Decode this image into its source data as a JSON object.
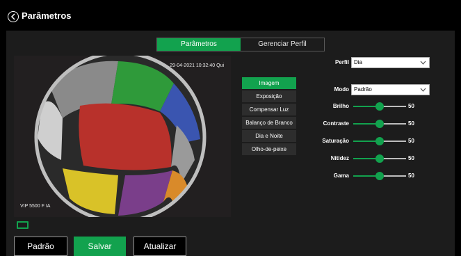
{
  "header": {
    "title": "Parâmetros",
    "back_icon": "chevron-left-circle-icon"
  },
  "tabs": [
    {
      "label": "Parâmetros",
      "active": true
    },
    {
      "label": "Gerenciar Perfil",
      "active": false
    }
  ],
  "preview": {
    "timestamp": "29-04-2021 10:32:40 Qui",
    "model": "VIP 5500 F IA"
  },
  "side_menu": [
    {
      "label": "Imagem",
      "active": true
    },
    {
      "label": "Exposição",
      "active": false
    },
    {
      "label": "Compensar Luz",
      "active": false
    },
    {
      "label": "Balanço de Branco",
      "active": false
    },
    {
      "label": "Dia e Noite",
      "active": false
    },
    {
      "label": "Olho-de-peixe",
      "active": false
    }
  ],
  "form": {
    "perfil": {
      "label": "Perfil",
      "value": "Dia"
    },
    "modo": {
      "label": "Modo",
      "value": "Padrão"
    },
    "sliders": [
      {
        "label": "Brilho",
        "value": 50
      },
      {
        "label": "Contraste",
        "value": 50
      },
      {
        "label": "Saturação",
        "value": 50
      },
      {
        "label": "Nitidez",
        "value": 50
      },
      {
        "label": "Gama",
        "value": 50
      }
    ]
  },
  "buttons": {
    "default": "Padrão",
    "save": "Salvar",
    "refresh": "Atualizar"
  },
  "colors": {
    "accent": "#12a24e",
    "panel": "#1c1c1c",
    "background": "#000000"
  }
}
